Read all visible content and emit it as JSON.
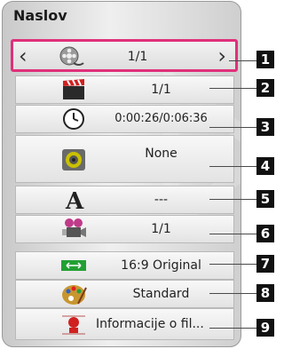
{
  "menu": {
    "title": "Naslov",
    "rows": [
      {
        "number": "1",
        "icon": "film-reel-icon",
        "value": "1/1",
        "has_arrows": true
      },
      {
        "number": "2",
        "icon": "clapperboard-icon",
        "value": "1/1"
      },
      {
        "number": "3",
        "icon": "clock-icon",
        "value": "0:00:26/0:06:36"
      },
      {
        "number": "4",
        "icon": "speaker-icon",
        "value": "None"
      },
      {
        "number": "5",
        "icon": "subtitle-letter-a-icon",
        "value": "---"
      },
      {
        "number": "6",
        "icon": "camera-angle-icon",
        "value": "1/1"
      },
      {
        "number": "7",
        "icon": "aspect-ratio-icon",
        "value": "16:9 Original"
      },
      {
        "number": "8",
        "icon": "picture-mode-palette-icon",
        "value": "Standard"
      },
      {
        "number": "9",
        "icon": "file-info-icon",
        "value": "Informacije o fil..."
      }
    ],
    "arrow_left": "‹",
    "arrow_right": "›"
  },
  "colors": {
    "selection_border": "#e0307a",
    "number_badge": "#111111"
  }
}
